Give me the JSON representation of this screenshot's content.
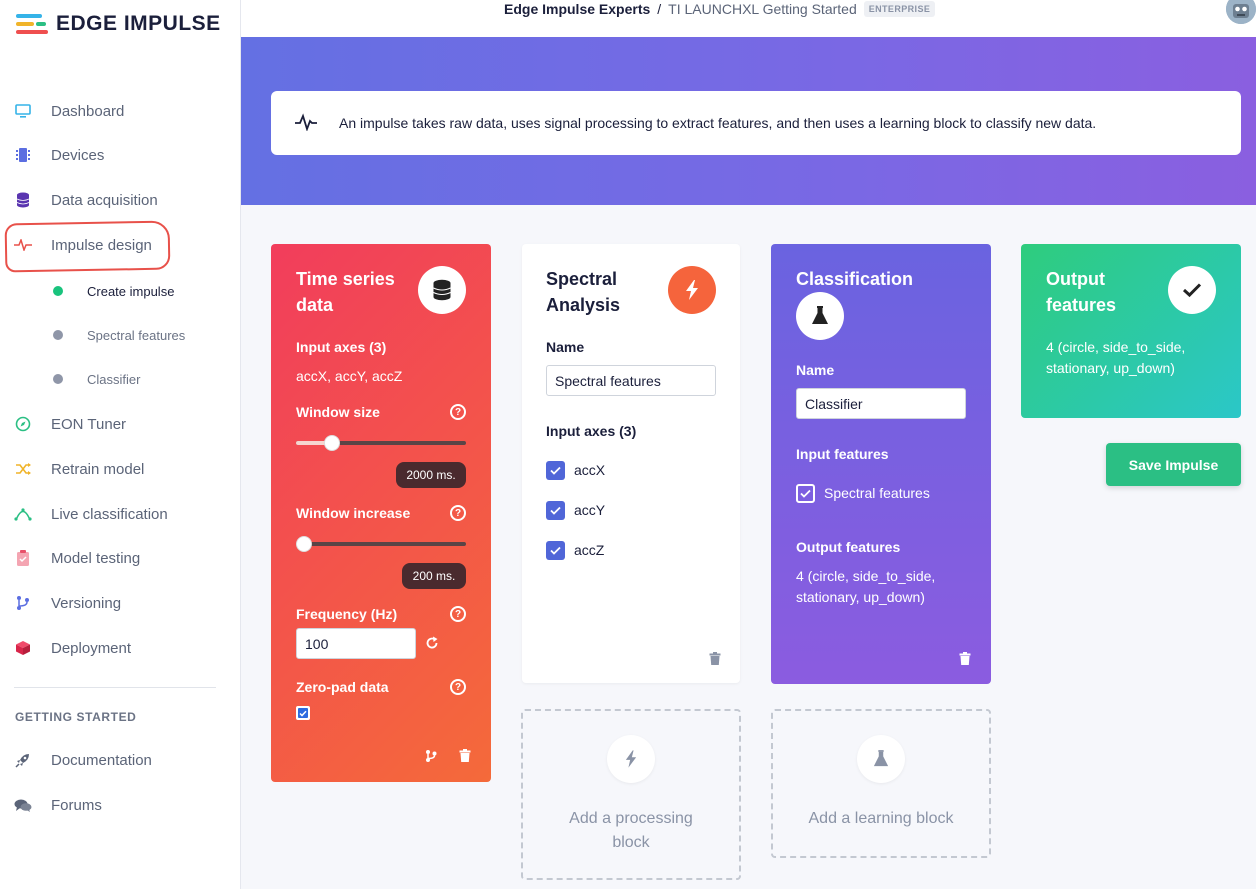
{
  "app": {
    "logo_text": "EDGE IMPULSE"
  },
  "sidebar": {
    "items": [
      {
        "label": "Dashboard",
        "icon": "monitor-icon"
      },
      {
        "label": "Devices",
        "icon": "chip-icon"
      },
      {
        "label": "Data acquisition",
        "icon": "database-icon"
      },
      {
        "label": "Impulse design",
        "icon": "pulse-icon"
      },
      {
        "label": "EON Tuner",
        "icon": "compass-icon"
      },
      {
        "label": "Retrain model",
        "icon": "shuffle-icon"
      },
      {
        "label": "Live classification",
        "icon": "signal-icon"
      },
      {
        "label": "Model testing",
        "icon": "clipboard-icon"
      },
      {
        "label": "Versioning",
        "icon": "branch-icon"
      },
      {
        "label": "Deployment",
        "icon": "box-icon"
      }
    ],
    "sub_items": [
      {
        "label": "Create impulse",
        "active": true
      },
      {
        "label": "Spectral features",
        "active": false
      },
      {
        "label": "Classifier",
        "active": false
      }
    ],
    "section_title": "GETTING STARTED",
    "section_items": [
      {
        "label": "Documentation",
        "icon": "rocket-icon"
      },
      {
        "label": "Forums",
        "icon": "chat-icon"
      }
    ]
  },
  "header": {
    "org": "Edge Impulse Experts",
    "separator": "/",
    "project": "TI LAUNCHXL Getting Started",
    "badge": "ENTERPRISE"
  },
  "info": {
    "text": "An impulse takes raw data, uses signal processing to extract features, and then uses a learning block to classify new data."
  },
  "time_series": {
    "title_line1": "Time series",
    "title_line2": "data",
    "input_axes_label": "Input axes (3)",
    "input_axes_value": "accX, accY, accZ",
    "window_size_label": "Window size",
    "window_size_value": "2000 ms.",
    "window_size_fraction": 0.21,
    "window_increase_label": "Window increase",
    "window_increase_value": "200 ms.",
    "window_increase_fraction": 0.03,
    "frequency_label": "Frequency (Hz)",
    "frequency_value": "100",
    "zero_pad_label": "Zero-pad data",
    "zero_pad_checked": true,
    "help": "?"
  },
  "spectral": {
    "title_line1": "Spectral",
    "title_line2": "Analysis",
    "name_label": "Name",
    "name_value": "Spectral features",
    "input_axes_label": "Input axes (3)",
    "axes": [
      "accX",
      "accY",
      "accZ"
    ]
  },
  "classification": {
    "title": "Classification",
    "name_label": "Name",
    "name_value": "Classifier",
    "input_features_label": "Input features",
    "input_feature": "Spectral features",
    "output_features_label": "Output features",
    "output_line1": "4 (circle, side_to_side,",
    "output_line2": "stationary, up_down)"
  },
  "output": {
    "title_line1": "Output",
    "title_line2": "features",
    "value_line1": "4 (circle, side_to_side,",
    "value_line2": "stationary, up_down)"
  },
  "actions": {
    "save_label": "Save Impulse",
    "add_processing_line1": "Add a processing",
    "add_processing_line2": "block",
    "add_learning": "Add a learning block"
  },
  "colors": {
    "accent_green": "#2bbf84",
    "time_series_from": "#f23d5c",
    "time_series_to": "#f46a3a",
    "spectral_circle": "#f5643c",
    "classification_from": "#6a63e0",
    "classification_to": "#8b5ce0",
    "output_from": "#2ecc7d",
    "output_to": "#2bc7c8"
  }
}
